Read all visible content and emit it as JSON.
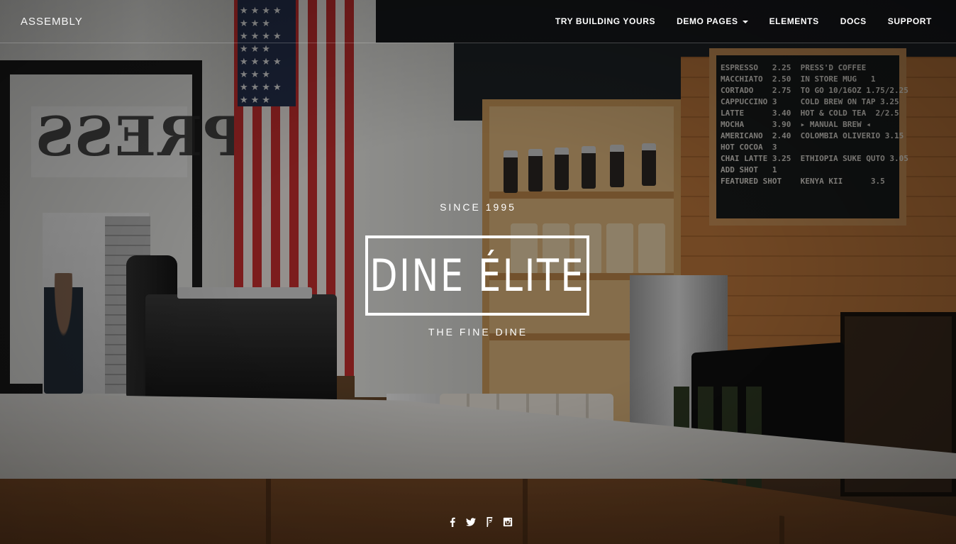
{
  "nav": {
    "brand": "ASSEMBLY",
    "links": [
      {
        "label": "TRY BUILDING YOURS",
        "has_dropdown": false
      },
      {
        "label": "DEMO PAGES",
        "has_dropdown": true
      },
      {
        "label": "ELEMENTS",
        "has_dropdown": false
      },
      {
        "label": "DOCS",
        "has_dropdown": false
      },
      {
        "label": "SUPPORT",
        "has_dropdown": false
      }
    ]
  },
  "hero": {
    "since": "SINCE 1995",
    "title": "DINE ÉLITE",
    "tagline": "THE FINE DINE",
    "background_image": "cafe-counter-interior"
  },
  "social": [
    {
      "icon": "facebook-icon"
    },
    {
      "icon": "twitter-icon"
    },
    {
      "icon": "foursquare-icon"
    },
    {
      "icon": "instagram-icon"
    }
  ],
  "colors": {
    "text": "#ffffff",
    "overlay": "rgba(0,0,0,0.38)"
  }
}
